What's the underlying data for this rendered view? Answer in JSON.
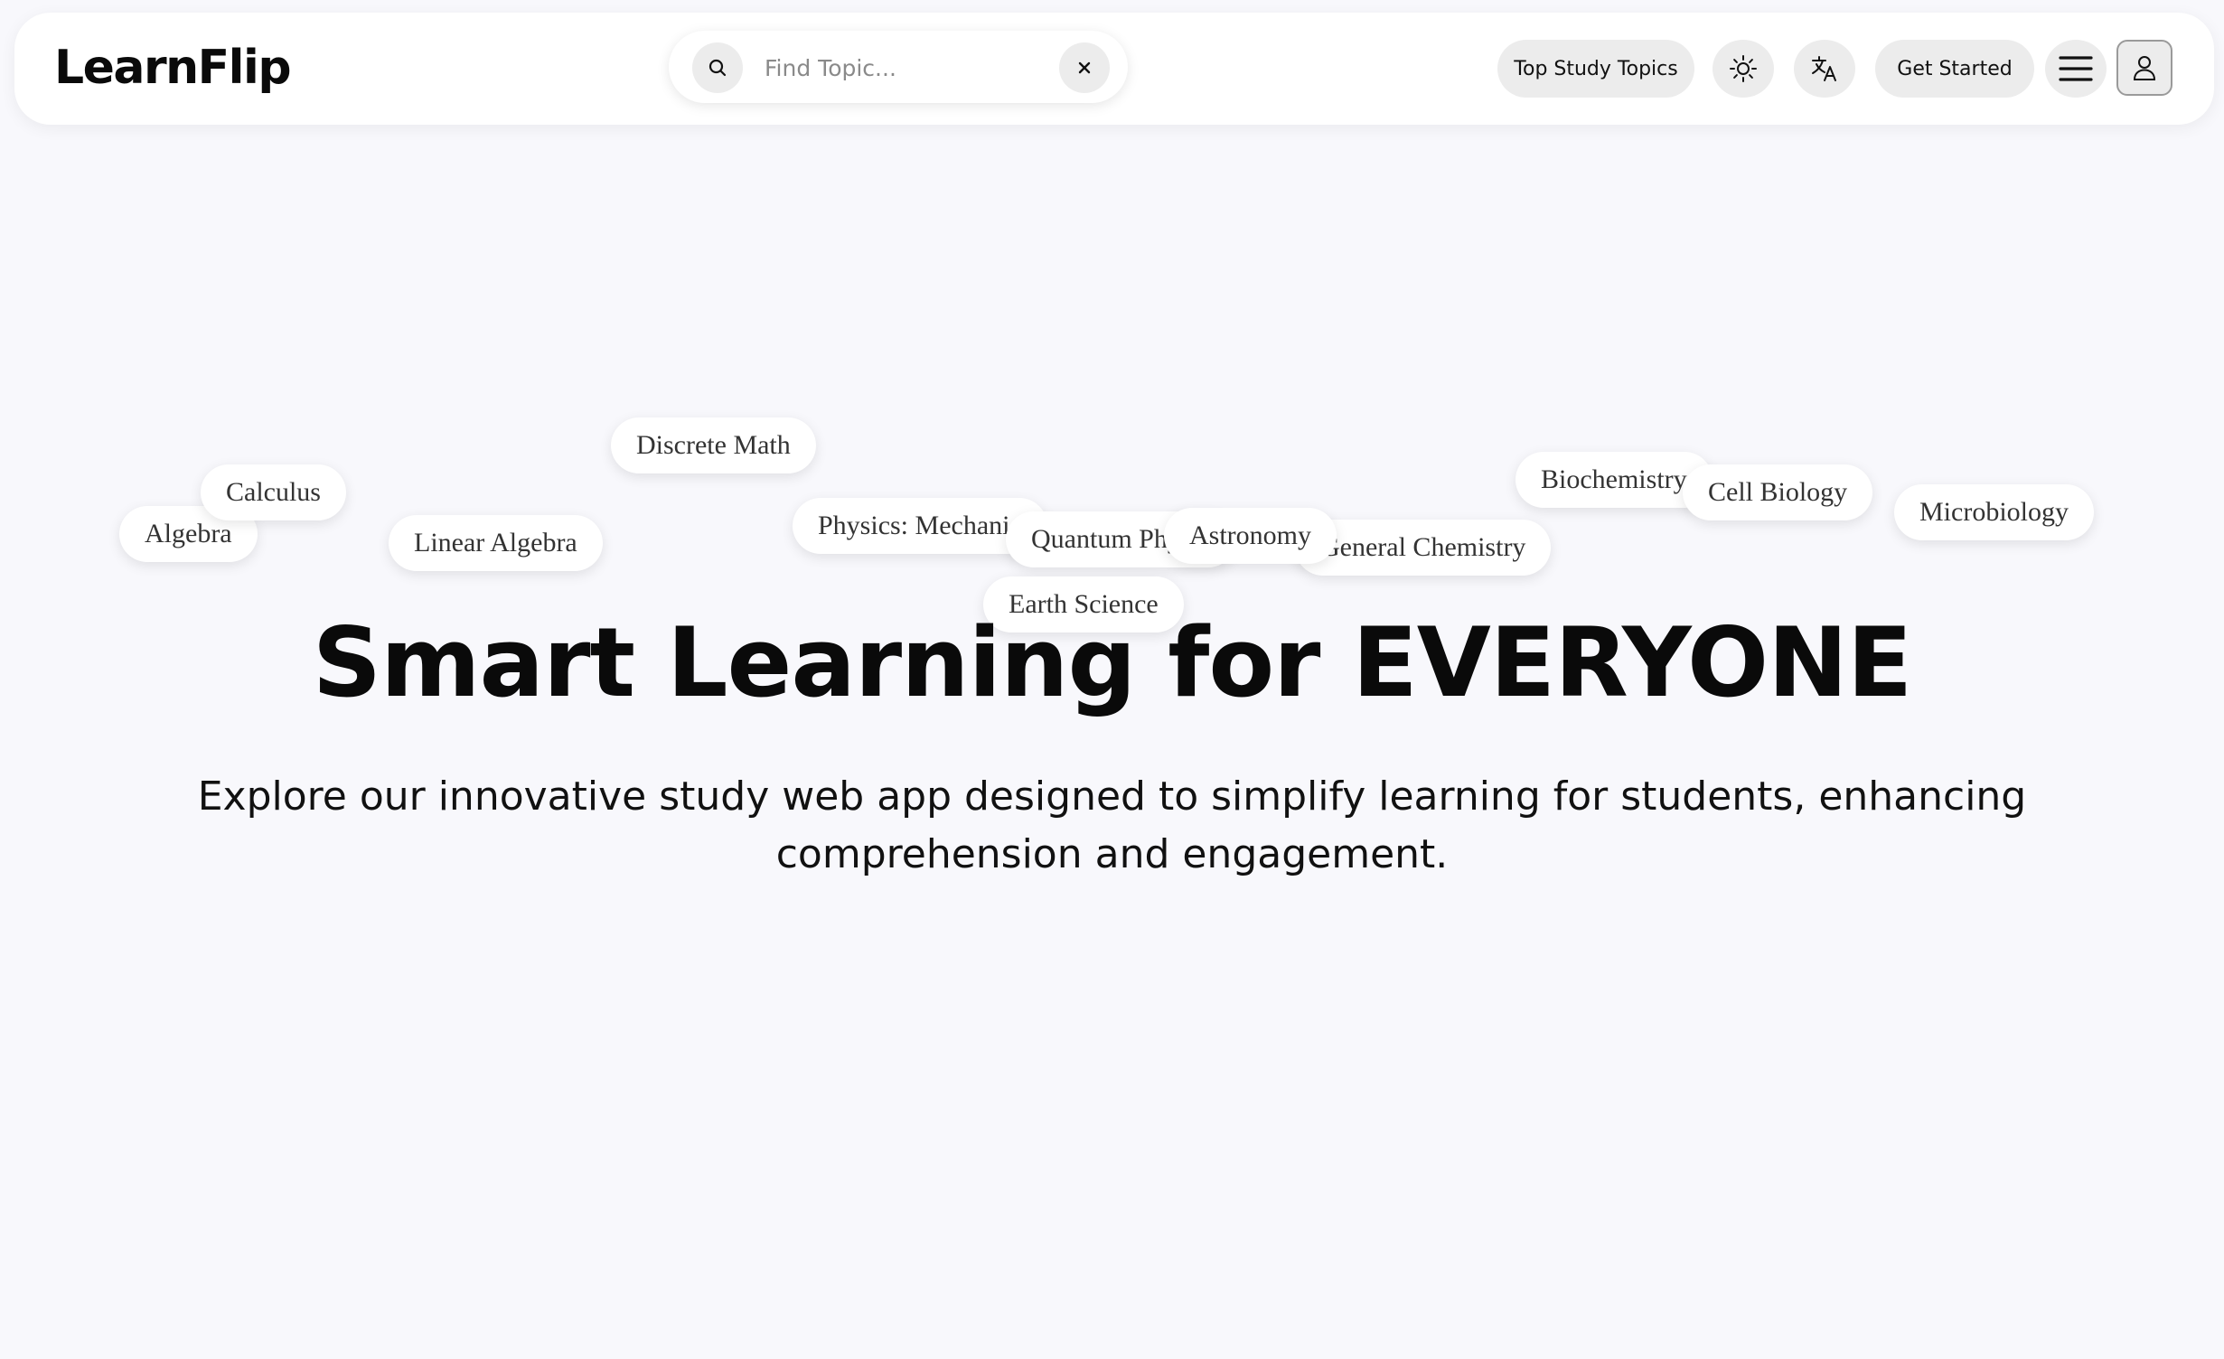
{
  "header": {
    "logo": "LearnFlip",
    "search": {
      "placeholder": "Find Topic...",
      "value": ""
    },
    "top_topics_label": "Top Study Topics",
    "get_started_label": "Get Started"
  },
  "topics": [
    "Algebra",
    "Calculus",
    "Linear Algebra",
    "Discrete Math",
    "Physics: Mechanics",
    "Quantum Physics",
    "Earth Science",
    "General Chemistry",
    "Astronomy",
    "Biochemistry",
    "Cell Biology",
    "Microbiology"
  ],
  "hero": {
    "title": "Smart Learning for EVERYONE",
    "subtitle": "Explore our innovative study web app designed to simplify learning for students, enhancing comprehension and engagement."
  }
}
